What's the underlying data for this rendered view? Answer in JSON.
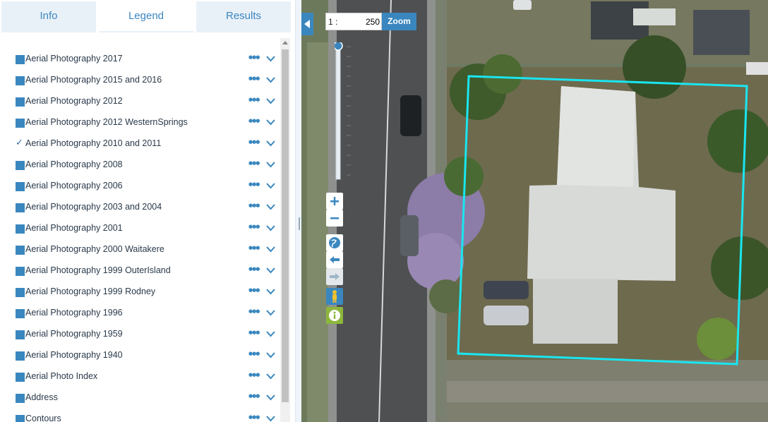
{
  "tabs": [
    {
      "label": "Info"
    },
    {
      "label": "Legend"
    },
    {
      "label": "Results"
    }
  ],
  "active_tab": "Legend",
  "legend_items": [
    {
      "label": "Aerial Photography 2017",
      "checked": false
    },
    {
      "label": "Aerial Photography 2015 and 2016",
      "checked": false
    },
    {
      "label": "Aerial Photography 2012",
      "checked": false
    },
    {
      "label": "Aerial Photography 2012 WesternSprings",
      "checked": false
    },
    {
      "label": "Aerial Photography 2010 and 2011",
      "checked": true
    },
    {
      "label": "Aerial Photography 2008",
      "checked": false
    },
    {
      "label": "Aerial Photography 2006",
      "checked": false
    },
    {
      "label": "Aerial Photography 2003 and 2004",
      "checked": false
    },
    {
      "label": "Aerial Photography 2001",
      "checked": false
    },
    {
      "label": "Aerial Photography 2000 Waitakere",
      "checked": false
    },
    {
      "label": "Aerial Photography 1999 OuterIsland",
      "checked": false
    },
    {
      "label": "Aerial Photography 1999 Rodney",
      "checked": false
    },
    {
      "label": "Aerial Photography 1996",
      "checked": false
    },
    {
      "label": "Aerial Photography 1959",
      "checked": false
    },
    {
      "label": "Aerial Photography 1940",
      "checked": false
    },
    {
      "label": "Aerial Photo Index",
      "checked": false
    },
    {
      "label": "Address",
      "checked": false
    },
    {
      "label": "Contours",
      "checked": false
    }
  ],
  "item_more_icon": "more-dots-icon",
  "item_expand_icon": "chevron-down-icon",
  "scale": {
    "prefix": "1 :",
    "value": "250"
  },
  "zoom_button_label": "Zoom",
  "zoom_slider_level": 1.0,
  "map_tools": [
    "zoom-in-icon",
    "zoom-out-icon",
    "globe-icon",
    "back-arrow-icon",
    "forward-arrow-icon",
    "street-view-person-icon",
    "info-icon"
  ],
  "colors": {
    "accent": "#3a87bf",
    "tab_bg": "#e9f1f8",
    "selection_outline": "#19e6f0"
  }
}
